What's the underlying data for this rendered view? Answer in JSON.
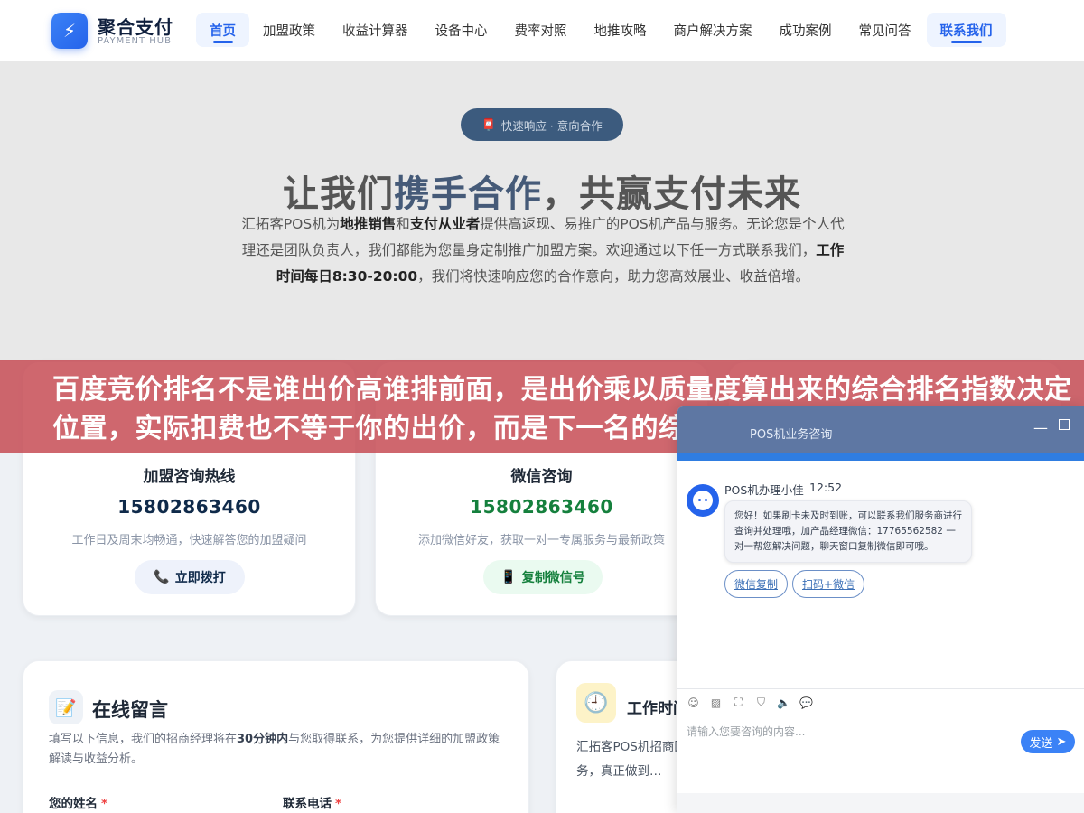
{
  "brand": {
    "name": "聚合支付",
    "sub": "PAYMENT HUB",
    "icon": "lightning-icon"
  },
  "nav": {
    "items": [
      "首页",
      "加盟政策",
      "收益计算器",
      "设备中心",
      "费率对照",
      "地推攻略",
      "商户解决方案",
      "成功案例",
      "常见问答"
    ],
    "contact": "联系我们"
  },
  "hero": {
    "pill": "快速响应 · 意向合作",
    "title_plain_1": "让我们",
    "title_highlight": "携手合作",
    "title_plain_2": "，共赢支付未来",
    "desc_1": "汇拓客POS机为",
    "desc_b1": "地推销售",
    "desc_2": "和",
    "desc_b2": "支付从业者",
    "desc_3": "提供高返现、易推广的POS机产品与服务。无论您是个人代理还是团队负责人，我们都能为您量身定制推广加盟方案。欢迎通过以下任一方式联系我们，",
    "desc_b3": "工作时间每日8:30-20:00",
    "desc_4": "，我们将快速响应您的合作意向，助力您高效展业、收益倍增。"
  },
  "cards": [
    {
      "title": "加盟咨询热线",
      "number": "15802863460",
      "desc": "工作日及周末均畅通，快速解答您的加盟疑问",
      "button": "立即拨打",
      "color": "#0f2a4a"
    },
    {
      "title": "微信咨询",
      "number": "15802863460",
      "desc": "添加微信好友，获取一对一专属服务与最新政策",
      "button": "复制微信号",
      "color": "#15803d"
    }
  ],
  "form": {
    "title": "在线留言",
    "desc_1": "填写以下信息，我们的招商经理将在",
    "desc_b": "30分钟内",
    "desc_2": "与您取得联系，为您提供详细的加盟政策解读与收益分析。",
    "label_name": "您的姓名",
    "label_phone": "联系电话",
    "required_mark": "*"
  },
  "hours": {
    "title": "工作时间",
    "desc": "汇拓客POS机招商团队…是在展业途中还是…供服务，真正做到…"
  },
  "banner": {
    "text": "百度竞价排名不是谁出价高谁排前面，是出价乘以质量度算出来的综合排名指数决定位置，实际扣费也不等于你的出价，而是下一名的综合排名指"
  },
  "chat": {
    "header_title": "POS机业务咨询",
    "agent_name": "POS机办理小佳",
    "time": "12:52",
    "message": "您好！如果刷卡未及时到账，可以联系我们服务商进行查询并处理哦，加产品经理微信：17765562582 一对一帮您解决问题，聊天窗口复制微信即可哦。",
    "quick_1": "微信复制",
    "quick_2": "扫码+微信",
    "placeholder": "请输入您要咨询的内容...",
    "send": "发送"
  }
}
